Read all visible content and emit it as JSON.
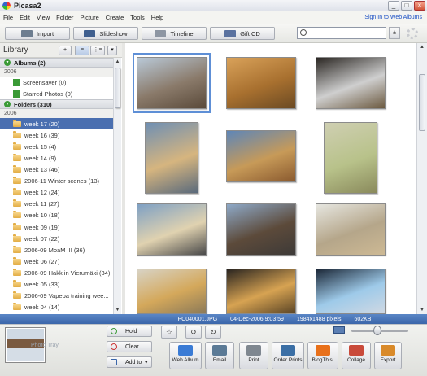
{
  "window": {
    "title": "Picasa2",
    "buttons": [
      "_",
      "□",
      "×"
    ]
  },
  "menu": {
    "items": [
      "File",
      "Edit",
      "View",
      "Folder",
      "Picture",
      "Create",
      "Tools",
      "Help"
    ],
    "signin": "Sign In to Web Albums"
  },
  "toolbar": {
    "import": "Import",
    "slideshow": "Slideshow",
    "timeline": "Timeline",
    "giftcd": "Gift CD",
    "search_value": "",
    "search_mode": "±"
  },
  "library": {
    "title": "Library",
    "albums_header": "Albums (2)",
    "albums_year": "2006",
    "albums": [
      "Screensaver (0)",
      "Starred Photos (0)"
    ],
    "folders_header": "Folders (310)",
    "folders_year": "2006",
    "folders": [
      "week 17 (20)",
      "week 16 (39)",
      "week 15 (4)",
      "week 14 (9)",
      "week 13 (46)",
      "2006-11 Winter scenes (13)",
      "week 12 (24)",
      "week 11 (27)",
      "week 10 (18)",
      "week 09 (19)",
      "week 07 (22)",
      "2006-09 MoaM III (36)",
      "week 06 (27)",
      "2006-09 Hakk in Vierumäki (34)",
      "week 05 (33)",
      "2006-09 Vapepa training wee...",
      "week 04 (14)"
    ],
    "selected_index": 0
  },
  "thumbnails": [
    {
      "colors": [
        "#b9c9d8",
        "#8a7a6a",
        "#5a4a3a"
      ],
      "selected": true
    },
    {
      "colors": [
        "#d9a25a",
        "#a8702f",
        "#6b4a23"
      ]
    },
    {
      "colors": [
        "#2a2622",
        "#cfcfcf",
        "#6c5a40"
      ]
    },
    {
      "colors": [
        "#6f8fb3",
        "#d6b57f",
        "#5a6a7c"
      ]
    },
    {
      "colors": [
        "#5e86b8",
        "#c79a58",
        "#8a5a2f"
      ]
    },
    {
      "colors": [
        "#cfcfb2",
        "#b8c28a",
        "#8a8a5c"
      ]
    },
    {
      "colors": [
        "#7ea0c4",
        "#e0d2b0",
        "#4a4a4a"
      ]
    },
    {
      "colors": [
        "#8ea9c8",
        "#5c4a3a",
        "#3d3a38"
      ]
    },
    {
      "colors": [
        "#e6e6e0",
        "#b5a68a",
        "#cdb994"
      ]
    },
    {
      "colors": [
        "#d8d3c5",
        "#d4a85b",
        "#8c7a58"
      ]
    },
    {
      "colors": [
        "#2a2520",
        "#d7a352",
        "#5b4526"
      ]
    },
    {
      "colors": [
        "#1c2838",
        "#9ecae9",
        "#cfd8e3"
      ]
    }
  ],
  "status": {
    "filename": "PC040001.JPG",
    "date": "04-Dec-2006 9:03:59",
    "dims": "1984x1488 pixels",
    "size": "602KB"
  },
  "tray": {
    "photo_label": "Photo Tray",
    "hold": "Hold",
    "clear": "Clear",
    "addto": "Add to",
    "zoom_level": 0.45,
    "actions": [
      {
        "label": "Web Album",
        "color": "#3a7bd5"
      },
      {
        "label": "Email",
        "color": "#5b7a96"
      },
      {
        "label": "Print",
        "color": "#7f8790"
      },
      {
        "label": "Order Prints",
        "color": "#3a6ea5"
      },
      {
        "label": "BlogThis!",
        "color": "#e8701a"
      },
      {
        "label": "Collage",
        "color": "#c94a3a"
      },
      {
        "label": "Export",
        "color": "#d98a2a"
      }
    ]
  }
}
